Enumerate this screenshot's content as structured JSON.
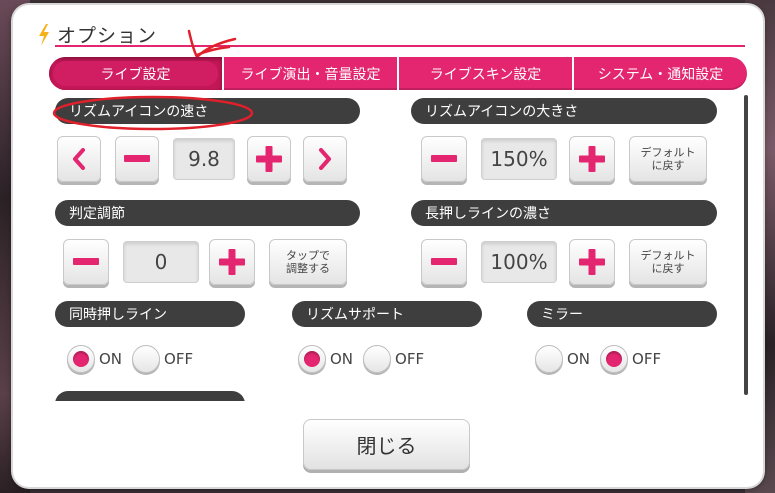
{
  "dialog": {
    "title": "オプション",
    "close_label": "閉じる"
  },
  "tabs": [
    {
      "label": "ライブ設定",
      "active": true
    },
    {
      "label": "ライブ演出・音量設定",
      "active": false
    },
    {
      "label": "ライブスキン設定",
      "active": false
    },
    {
      "label": "システム・通知設定",
      "active": false
    }
  ],
  "settings": {
    "rhythm_speed": {
      "label": "リズムアイコンの速さ",
      "value": "9.8"
    },
    "rhythm_size": {
      "label": "リズムアイコンの大きさ",
      "value": "150%",
      "default_label": "デフォルト\nに戻す"
    },
    "judgement": {
      "label": "判定調節",
      "value": "0",
      "tap_label": "タップで\n調整する"
    },
    "long_line": {
      "label": "長押しラインの濃さ",
      "value": "100%",
      "default_label": "デフォルト\nに戻す"
    },
    "simul_line": {
      "label": "同時押しライン",
      "selected": "ON"
    },
    "rhythm_support": {
      "label": "リズムサポート",
      "selected": "ON"
    },
    "mirror": {
      "label": "ミラー",
      "selected": "OFF"
    },
    "on_label": "ON",
    "off_label": "OFF"
  },
  "colors": {
    "accent": "#e3266f",
    "pill_bg": "#3e3e3e",
    "annotation": "#e0202a"
  },
  "icons": [
    "lightning-icon",
    "chevron-left-icon",
    "chevron-right-icon",
    "minus-icon",
    "plus-icon"
  ]
}
